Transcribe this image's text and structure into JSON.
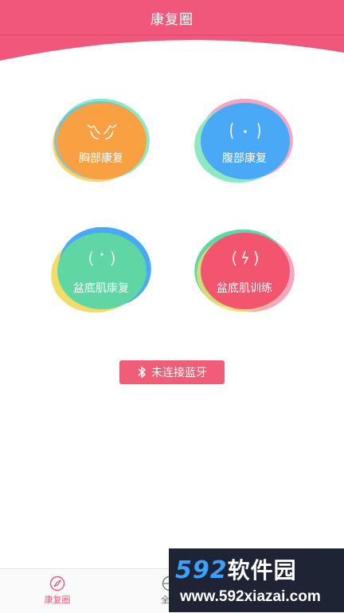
{
  "header": {
    "title": "康复圈"
  },
  "modules": [
    {
      "label": "胸部康复",
      "icon": "chest-outline-icon"
    },
    {
      "label": "腹部康复",
      "icon": "abdomen-outline-icon"
    },
    {
      "label": "盆底肌康复",
      "icon": "pelvic-floor-outline-icon"
    },
    {
      "label": "盆底肌训练",
      "icon": "pelvic-training-outline-icon"
    }
  ],
  "bluetooth": {
    "label": "未连接蓝牙",
    "icon": "bluetooth-icon"
  },
  "tabs": [
    {
      "label": "康复圈",
      "icon": "compass-icon",
      "active": true
    },
    {
      "label": "全部",
      "icon": "globe-icon",
      "active": false
    }
  ],
  "watermark": {
    "brand": "592",
    "brand_cn": "软件园",
    "url": "www.592xiazai.com"
  },
  "colors": {
    "header": "#f0577a",
    "chest": "#f9a043",
    "abdomen": "#4aa9f6",
    "pelvic": "#5fd6a4",
    "training": "#f3546e",
    "button": "#ef5d76",
    "tab_active": "#f0577a"
  }
}
